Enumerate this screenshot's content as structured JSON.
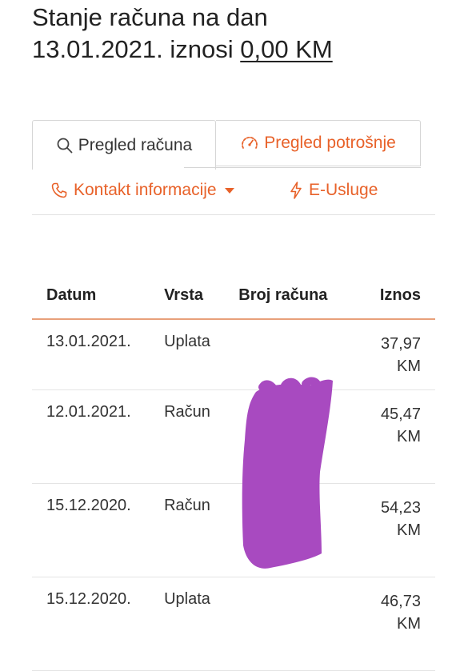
{
  "balance": {
    "text_line1": "Stanje računa na dan",
    "text_line2_prefix": "13.01.2021. iznosi ",
    "amount": "0,00 KM"
  },
  "tabs": [
    {
      "label": "Pregled računa",
      "icon": "search-icon",
      "active": true
    },
    {
      "label": "Pregled potrošnje",
      "icon": "gauge-icon",
      "active": false
    }
  ],
  "links": {
    "contact": {
      "label": "Kontakt informacije",
      "icon": "phone-icon"
    },
    "eservices": {
      "label": "E-Usluge",
      "icon": "lightning-icon"
    }
  },
  "table": {
    "headers": {
      "date": "Datum",
      "type": "Vrsta",
      "number": "Broj računa",
      "amount": "Iznos"
    },
    "rows": [
      {
        "date": "13.01.2021.",
        "type": "Uplata",
        "number": "",
        "amount": "37,97",
        "currency": "KM"
      },
      {
        "date": "12.01.2021.",
        "type": "Račun",
        "number": "",
        "amount": "45,47",
        "currency": "KM"
      },
      {
        "date": "15.12.2020.",
        "type": "Račun",
        "number": "",
        "amount": "54,23",
        "currency": "KM"
      },
      {
        "date": "15.12.2020.",
        "type": "Uplata",
        "number": "",
        "amount": "46,73",
        "currency": "KM"
      }
    ]
  },
  "colors": {
    "accent": "#e8622a",
    "redaction": "#a84ac0"
  }
}
